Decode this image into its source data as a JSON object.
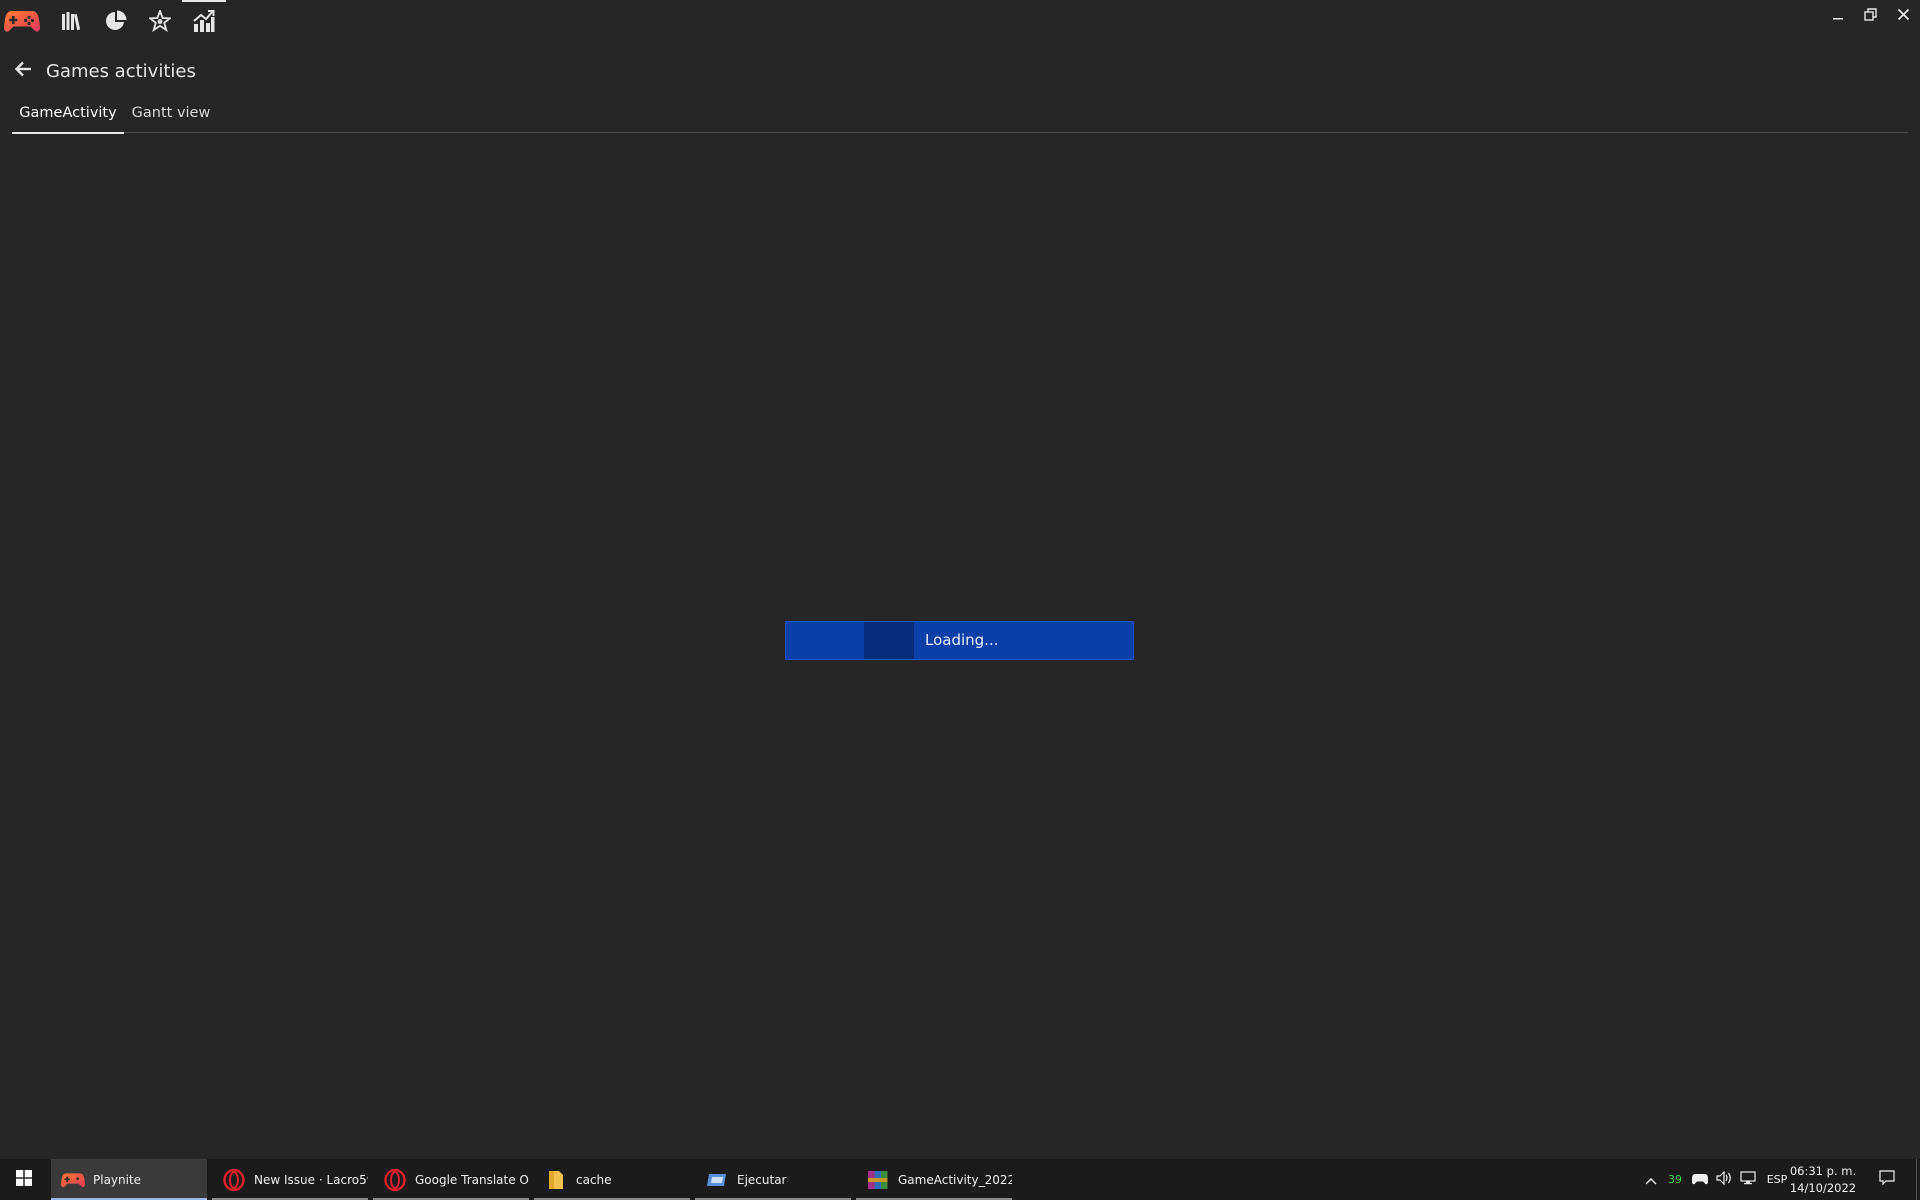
{
  "app": {
    "name": "Playnite"
  },
  "topnav": {
    "items": [
      {
        "name": "app-logo",
        "icon": "gamepad-icon"
      },
      {
        "name": "library",
        "icon": "library-books-icon"
      },
      {
        "name": "statistics",
        "icon": "pie-chart-icon"
      },
      {
        "name": "success-story",
        "icon": "star-badge-icon"
      },
      {
        "name": "game-activity",
        "icon": "chart-trend-icon",
        "active": true
      }
    ]
  },
  "window_controls": {
    "minimize": "minimize-icon",
    "restore": "restore-icon",
    "close": "close-icon"
  },
  "header": {
    "title": "Games activities"
  },
  "tabs": [
    {
      "label": "GameActivity",
      "active": true
    },
    {
      "label": "Gantt view",
      "active": false
    }
  ],
  "loading": {
    "text": "Loading..."
  },
  "taskbar": {
    "items": [
      {
        "label": "Playnite",
        "icon": "playnite-gamepad-icon",
        "active": true
      },
      {
        "label": "New Issue · Lacro59...",
        "icon": "opera-icon"
      },
      {
        "label": "Google Translate O...",
        "icon": "opera-icon"
      },
      {
        "label": "cache",
        "icon": "folder-icon"
      },
      {
        "label": "Ejecutar",
        "icon": "run-icon"
      },
      {
        "label": "GameActivity_2022...",
        "icon": "winrar-icon"
      }
    ],
    "tray": {
      "badge_count": "39",
      "language": "ESP"
    },
    "clock": {
      "time": "06:31 p. m.",
      "date": "14/10/2022"
    }
  },
  "colors": {
    "background": "#262626",
    "loading_fill": "#0b3fa8",
    "taskbar": "#1b1b1b",
    "accent_logo": "#e8433a"
  }
}
